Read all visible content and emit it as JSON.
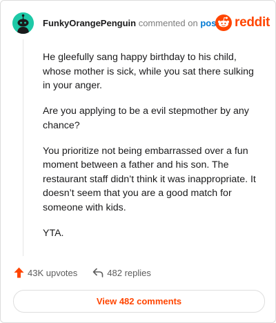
{
  "comment": {
    "username": "FunkyOrangePenguin",
    "action_text": "commented on",
    "post_link": "post",
    "paragraphs": [
      "He gleefully sang happy birthday to his child, whose mother is sick, while you sat there sulking in your anger.",
      "Are you applying to be a evil stepmother by any chance?",
      "You prioritize not being embarrassed over a fun moment between a father and his son. The restaurant staff didn’t think it was inappropriate. It doesn’t seem that you are a good match for someone with kids.",
      "YTA."
    ]
  },
  "brand": {
    "wordmark": "reddit",
    "color": "#ff4500"
  },
  "avatar": {
    "bg_color": "#1ec9a7"
  },
  "stats": {
    "upvotes": "43K upvotes",
    "replies": "482 replies"
  },
  "footer": {
    "view_comments_label": "View 482 comments"
  },
  "icons": {
    "avatar": "snoo-avatar-icon",
    "logo": "reddit-logo-icon",
    "upvote": "upvote-arrow-icon",
    "reply": "reply-arrow-icon"
  }
}
